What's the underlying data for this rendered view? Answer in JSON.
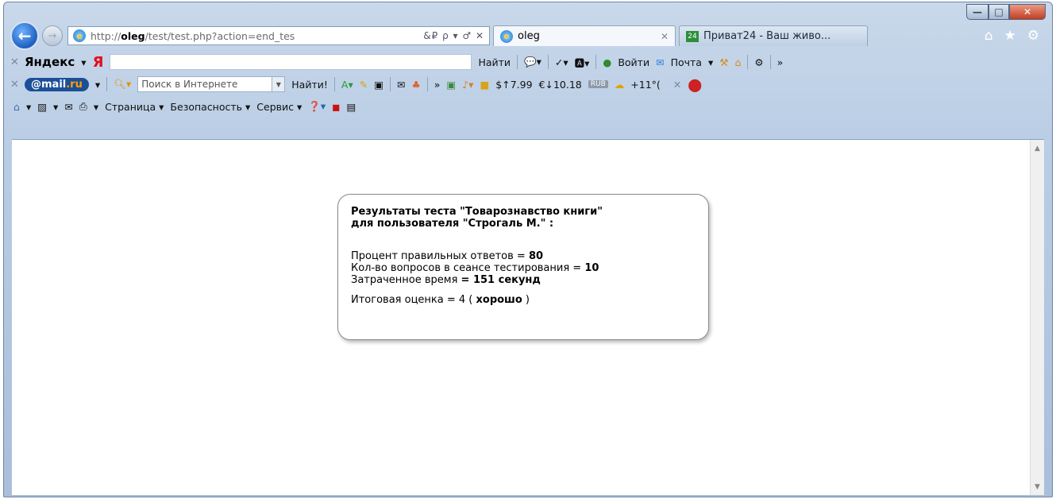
{
  "browser": {
    "address_url_prefix": "http://",
    "address_url_host": "oleg",
    "address_url_path": "/test/test.php?action=end_tes",
    "address_tools": "&₽ ρ ▾ ♂ ✕",
    "tabs": [
      {
        "label": "oleg",
        "active": true
      },
      {
        "label": "Приват24 - Ваш живо...",
        "active": false
      }
    ]
  },
  "yandex_bar": {
    "brand": "Яндекс",
    "logo": "Я",
    "find_button": "Найти",
    "login": "Войти",
    "mail": "Почта"
  },
  "mailru_bar": {
    "brand_mail": "mail",
    "brand_ru": ".ru",
    "search_placeholder": "Поиск в Интернете",
    "find_button": "Найти!",
    "usd_rate": "$↑7.99",
    "eur_rate": "€↓10.18",
    "rub_label": "RUB",
    "weather": "+11°("
  },
  "command_bar": {
    "page": "Страница",
    "safety": "Безопасность",
    "tools": "Сервис"
  },
  "result": {
    "title_line1": "Результаты теста \"Товарознавство книги\"",
    "title_line2": "для пользователя \"Строгаль М.\" :",
    "correct_label": "Процент правильных ответов = ",
    "correct_value": "80",
    "questions_label": "Кол-во вопросов в сеансе тестирования = ",
    "questions_value": "10",
    "time_label": "Затраченное время ",
    "time_value": "= 151 секунд",
    "grade_label": "Итоговая оценка = 4 ( ",
    "grade_value": "хорошо",
    "grade_suffix": " )"
  }
}
